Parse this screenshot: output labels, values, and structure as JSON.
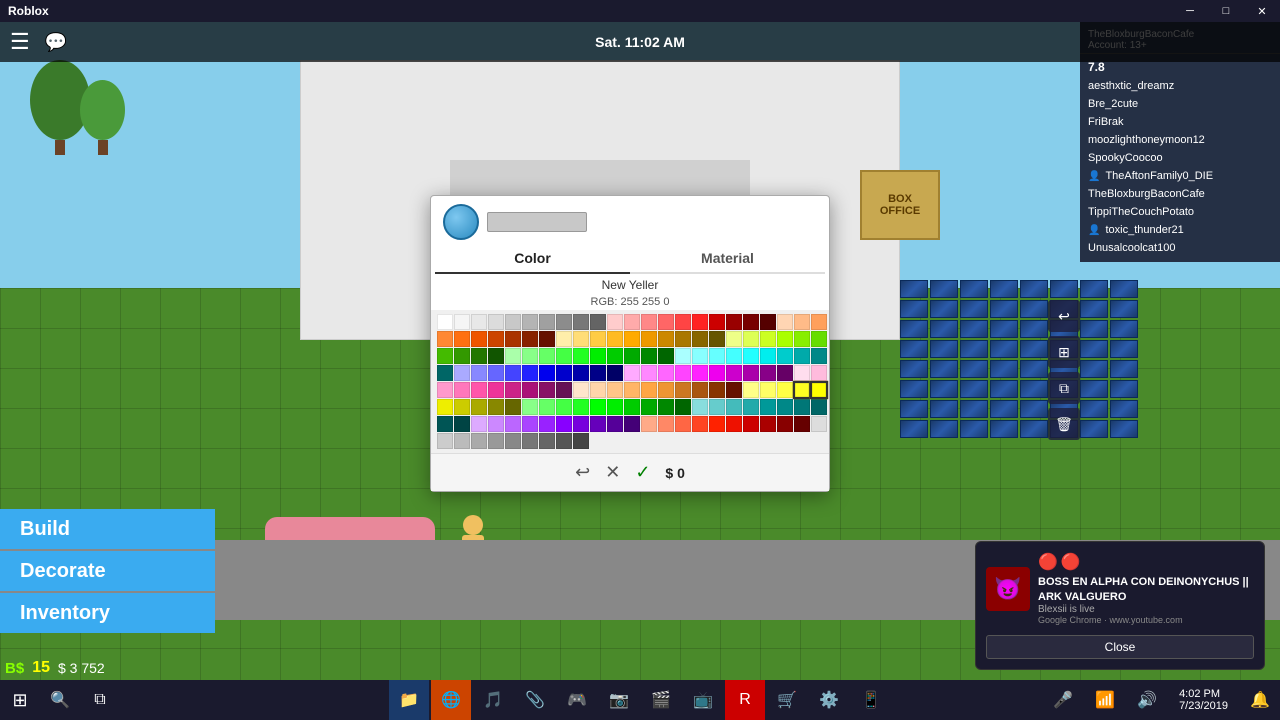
{
  "titleBar": {
    "title": "Roblox",
    "minimizeIcon": "─",
    "maximizeIcon": "□",
    "closeIcon": "✕"
  },
  "hudBar": {
    "menuIcon": "☰",
    "chatIcon": "💬",
    "timeText": "Sat. 11:02 AM",
    "accountLabel": "Account: 13+"
  },
  "rightSidebar": {
    "username": "TheBloxburgBaconCafe",
    "robux": "7.8",
    "players": [
      {
        "name": "aesthxtic_dreamz",
        "hasIcon": false
      },
      {
        "name": "Bre_2cute",
        "hasIcon": false
      },
      {
        "name": "FriBrak",
        "hasIcon": false
      },
      {
        "name": "moozlighthoneymoon12",
        "hasIcon": false
      },
      {
        "name": "SpookyCoocoo",
        "hasIcon": false
      },
      {
        "name": "TheAftonFamily0_DIE",
        "hasIcon": true
      },
      {
        "name": "TheBloxburgBaconCafe",
        "hasIcon": false
      },
      {
        "name": "TippiTheCouchPotato",
        "hasIcon": false
      },
      {
        "name": "toxic_thunder21",
        "hasIcon": true
      },
      {
        "name": "Unusalcoolcat100",
        "hasIcon": false
      }
    ]
  },
  "colorPicker": {
    "colorTab": "Color",
    "materialTab": "Material",
    "colorName": "New Yeller",
    "rgbLabel": "RGB:",
    "rgbR": "255",
    "rgbG": "255",
    "rgbB": "0",
    "price": "$ 0",
    "undoIcon": "↩",
    "cancelIcon": "✕",
    "confirmIcon": "✓"
  },
  "leftMenu": {
    "buildLabel": "Build",
    "decorateLabel": "Decorate",
    "inventoryLabel": "Inventory"
  },
  "bottomStatus": {
    "bsLabel": "B$",
    "bsAmount": "15",
    "dollarSign": "$",
    "dollarAmount": "3 752"
  },
  "notification": {
    "redDot1": "🔴",
    "redDot2": "🔴",
    "title": "BOSS EN ALPHA CON DEINONYCHUS || ARK VALGUERO",
    "streamer": "Blexsii is live",
    "source": "Google Chrome · www.youtube.com",
    "closeLabel": "Close"
  },
  "taskbar": {
    "time": "4:02 PM",
    "date": "7/23/2019"
  },
  "colorSwatches": [
    "#ffffff",
    "#f0f0f0",
    "#e0e0e0",
    "#c8c8c8",
    "#a0a0a0",
    "#808080",
    "#606060",
    "#404040",
    "#202020",
    "#000000",
    "#ffb3b3",
    "#ff8080",
    "#ff4040",
    "#ff0000",
    "#cc0000",
    "#990000",
    "#660000",
    "#440000",
    "#8b1a1a",
    "#a0522d",
    "#ffcc99",
    "#ff9966",
    "#ff6633",
    "#ff4400",
    "#cc3300",
    "#8b2500",
    "#5c1a00",
    "#4a1000",
    "#d2691e",
    "#cd853f",
    "#ffff99",
    "#ffff66",
    "#ffff33",
    "#ffff00",
    "#cccc00",
    "#999900",
    "#666600",
    "#4a4a00",
    "#9acd32",
    "#6b8e23",
    "#b3ffb3",
    "#80ff80",
    "#40ff40",
    "#00ff00",
    "#00cc00",
    "#009900",
    "#006600",
    "#004400",
    "#228b22",
    "#2e8b57",
    "#b3ffff",
    "#80ffff",
    "#40ffff",
    "#00ffff",
    "#00cccc",
    "#009999",
    "#006666",
    "#004444",
    "#008b8b",
    "#20b2aa",
    "#b3b3ff",
    "#8080ff",
    "#4040ff",
    "#0000ff",
    "#0000cc",
    "#000099",
    "#000066",
    "#000044",
    "#191970",
    "#483d8b",
    "#ffb3ff",
    "#ff80ff",
    "#ff40ff",
    "#ff00ff",
    "#cc00cc",
    "#990099",
    "#660066",
    "#440044",
    "#8b008b",
    "#9400d3",
    "#ffe4e1",
    "#ffc0cb",
    "#ffb6c1",
    "#ff69b4",
    "#ff1493",
    "#c71585",
    "#db7093",
    "#d2b48c",
    "#bc8f8f",
    "#f5deb3",
    "#daa520",
    "#b8860b",
    "#cd853f",
    "#8b4513",
    "#a0522d",
    "#6b4226",
    "#5c3317",
    "#3d2b1f",
    "#8b6914",
    "#cd950c",
    "#f0e68c",
    "#eee8aa",
    "#fafad2",
    "#fffacd",
    "#ffffe0",
    "#fffff0",
    "#f5f5dc",
    "#fdf5e6",
    "#fffaf0",
    "#fffff5",
    "#e6e6fa",
    "#d8bfd8",
    "#dda0dd",
    "#ee82ee",
    "#da70d6",
    "#ba55d3",
    "#9932cc",
    "#8a2be2",
    "#7b68ee",
    "#6a5acd",
    "#add8e6",
    "#87ceeb",
    "#87cefa",
    "#00bfff",
    "#1e90ff",
    "#4169e1",
    "#0000cd",
    "#00008b",
    "#000080",
    "#191970",
    "#90ee90",
    "#98fb98",
    "#00fa9a",
    "#00ff7f",
    "#7cfc00",
    "#adff2f",
    "#7fff00",
    "#66cd00",
    "#32cd32",
    "#3cb371",
    "#ff7f50",
    "#ff6347",
    "#ff4500",
    "#ff8c00",
    "#ffa500",
    "#ffb400",
    "#ffd700",
    "#ffec00",
    "#f4d03f",
    "#f39c12",
    "#c0c0c0",
    "#d3d3d3",
    "#dcdcdc",
    "#e8e8e8",
    "#f0f0f0",
    "#778899",
    "#708090",
    "#696969",
    "#808080",
    "#a9a9a9",
    "#2f4f4f",
    "#556b2f",
    "#8b4513",
    "#800000",
    "#808000",
    "#008080",
    "#000080",
    "#4b0082",
    "#800080",
    "#8b0000"
  ]
}
